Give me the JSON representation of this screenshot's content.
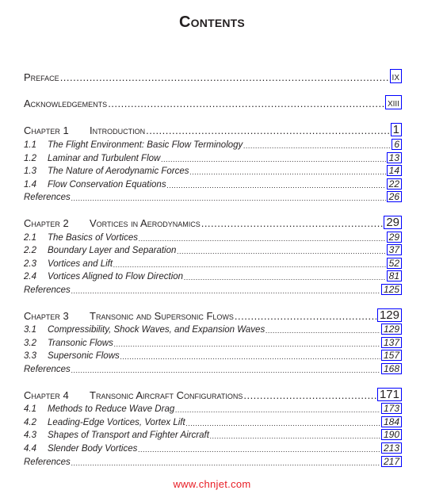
{
  "title": "Contents",
  "front_matter": [
    {
      "label": "Preface",
      "page": "ix"
    },
    {
      "label": "Acknowledgements",
      "page": "xiii"
    }
  ],
  "chapters": [
    {
      "number": "Chapter 1",
      "title": "Introduction",
      "page": "1",
      "sections": [
        {
          "no": "1.1",
          "title": "The Flight Environment: Basic Flow Terminology",
          "page": "6"
        },
        {
          "no": "1.2",
          "title": "Laminar and Turbulent Flow",
          "page": "13"
        },
        {
          "no": "1.3",
          "title": "The Nature of Aerodynamic Forces",
          "page": "14"
        },
        {
          "no": "1.4",
          "title": "Flow Conservation Equations",
          "page": "22"
        },
        {
          "no": "",
          "title": "References",
          "page": "26"
        }
      ]
    },
    {
      "number": "Chapter 2",
      "title": "Vortices in Aerodynamics",
      "page": "29",
      "sections": [
        {
          "no": "2.1",
          "title": "The Basics of Vortices",
          "page": "29"
        },
        {
          "no": "2.2",
          "title": "Boundary Layer and Separation",
          "page": "37"
        },
        {
          "no": "2.3",
          "title": "Vortices and Lift",
          "page": "52"
        },
        {
          "no": "2.4",
          "title": "Vortices Aligned to Flow Direction",
          "page": "81"
        },
        {
          "no": "",
          "title": "References",
          "page": "125"
        }
      ]
    },
    {
      "number": "Chapter 3",
      "title": "Transonic and Supersonic Flows",
      "page": "129",
      "sections": [
        {
          "no": "3.1",
          "title": "Compressibility, Shock Waves, and Expansion Waves",
          "page": "129"
        },
        {
          "no": "3.2",
          "title": "Transonic Flows",
          "page": "137"
        },
        {
          "no": "3.3",
          "title": "Supersonic Flows",
          "page": "157"
        },
        {
          "no": "",
          "title": "References",
          "page": "168"
        }
      ]
    },
    {
      "number": "Chapter 4",
      "title": "Transonic Aircraft Configurations",
      "page": "171",
      "sections": [
        {
          "no": "4.1",
          "title": "Methods to Reduce Wave Drag",
          "page": "173"
        },
        {
          "no": "4.2",
          "title": "Leading-Edge Vortices, Vortex Lift",
          "page": "184"
        },
        {
          "no": "4.3",
          "title": "Shapes of Transport and Fighter Aircraft",
          "page": "190"
        },
        {
          "no": "4.4",
          "title": "Slender Body Vortices",
          "page": "213"
        },
        {
          "no": "",
          "title": "References",
          "page": "217"
        }
      ]
    }
  ],
  "watermark": "www.chnjet.com",
  "colors": {
    "link_box": "#0000ff",
    "watermark": "#e81d25",
    "text": "#231f20"
  }
}
